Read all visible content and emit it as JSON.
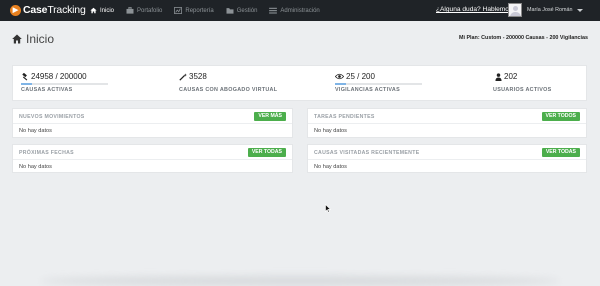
{
  "brand": {
    "name_bold": "Case",
    "name_rest": "Tracking"
  },
  "nav": {
    "items": [
      {
        "label": "Inicio",
        "icon": "home-icon",
        "active": true
      },
      {
        "label": "Portafolio",
        "icon": "briefcase-icon",
        "active": false
      },
      {
        "label": "Reportería",
        "icon": "chart-icon",
        "active": false
      },
      {
        "label": "Gestión",
        "icon": "folder-icon",
        "active": false
      },
      {
        "label": "Administración",
        "icon": "menu-icon",
        "active": false
      }
    ],
    "help_link": "¿Alguna duda? Hablemos",
    "user_name": "María José Román"
  },
  "page": {
    "title": "Inicio",
    "plan": "Mi Plan: Custom - 200000 Causas - 200 Vigilancias"
  },
  "stats": [
    {
      "value": "24958 / 200000",
      "label": "CAUSAS ACTIVAS",
      "icon": "gavel-icon",
      "progress": 0.125
    },
    {
      "value": "3528",
      "label": "CAUSAS CON ABOGADO VIRTUAL",
      "icon": "magic-wand-icon"
    },
    {
      "value": "25 / 200",
      "label": "VIGILANCIAS ACTIVAS",
      "icon": "eye-icon",
      "progress": 0.125
    },
    {
      "value": "202",
      "label": "USUARIOS ACTIVOS",
      "icon": "user-icon"
    }
  ],
  "panels": {
    "movimientos": {
      "title": "NUEVOS MOVIMIENTOS",
      "button": "VER MÁS",
      "empty": "No hay datos"
    },
    "tareas": {
      "title": "TAREAS PENDIENTES",
      "button": "VER TODOS",
      "empty": "No hay datos"
    },
    "fechas": {
      "title": "PRÓXIMAS FECHAS",
      "button": "VER TODAS",
      "empty": "No hay datos"
    },
    "visitadas": {
      "title": "CAUSAS VISITADAS RECIENTEMENTE",
      "button": "VER TODAS",
      "empty": "No hay datos"
    }
  },
  "colors": {
    "navbar": "#1f2327",
    "brand_orange": "#e8801e",
    "button_green": "#4cae4c",
    "progress_blue": "#7fb4e6"
  }
}
